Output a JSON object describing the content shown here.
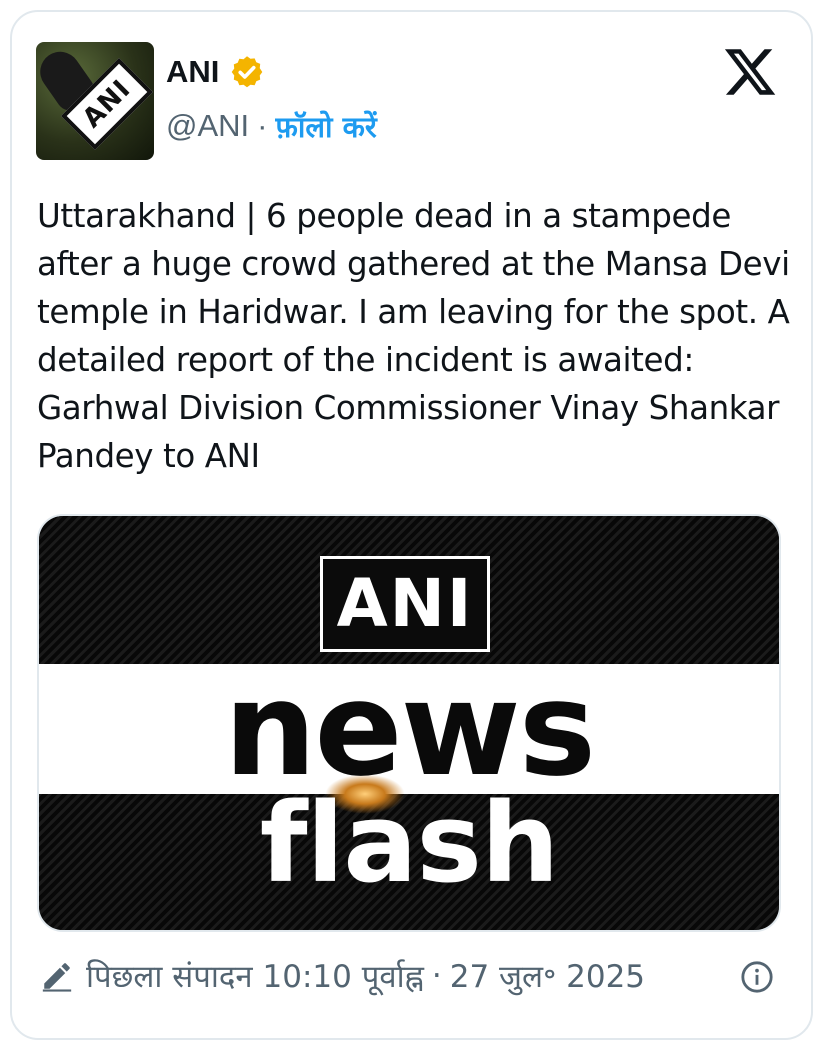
{
  "author": {
    "name": "ANI",
    "handle": "@ANI",
    "separator": "·",
    "follow_label": "फ़ॉलो करें",
    "avatar_text": "ANI",
    "verified_color": "#f4b400"
  },
  "tweet": {
    "text": "Uttarakhand | 6 people dead in a stampede after a huge crowd gathered at the Mansa Devi temple in Haridwar. I am leaving for the spot. A detailed report of the incident is awaited: Garhwal Division Commissioner Vinay Shankar Pandey to ANI"
  },
  "media": {
    "box_label": "ANI",
    "word1": "news",
    "word2": "flash"
  },
  "footer": {
    "edited_label": "पिछला संपादन",
    "time": "10:10 पूर्वाह्न",
    "separator": "·",
    "date": "27 जुल॰ 2025"
  },
  "colors": {
    "accent": "#1d9bf0",
    "muted": "#536471",
    "text": "#0f1419"
  }
}
